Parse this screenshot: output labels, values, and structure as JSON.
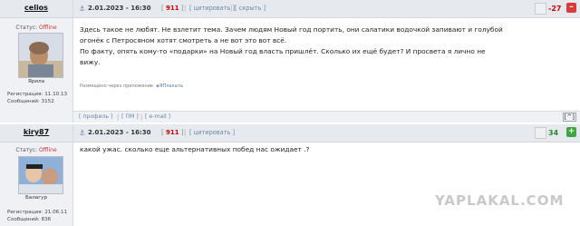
{
  "posts": [
    {
      "username": "celios",
      "status_label": "Статус:",
      "status_value": "Offline",
      "avatar_caption": "Ярила",
      "reg_label": "Регистрация:",
      "reg_date": "11.10.13",
      "msg_label": "Сообщений:",
      "msg_count": "3152",
      "date": "2.01.2023 - 16:30",
      "post_number": "911",
      "quote_label": "цитировать",
      "hide_label": "скрыть",
      "score": "-27",
      "score_color": "#cc0000",
      "body_lines": [
        "Здесь такое не любят. Не взлетит тема. Зачем людям Новый год портить, они салатики водочкой запивают и голубой",
        "огонёк с Петросяном хотят смотреть а не вот это вот всё.",
        "По факту, опять кому-то «подарки» на Новый год власть пришлёт. Сколько их ещё будет? И просвета я лично не",
        "вижу."
      ],
      "via_text": "Размещено через приложение",
      "via_app": "ЯПлакалъ",
      "footer_links": [
        "профиль",
        "ПМ",
        "e-mail"
      ]
    },
    {
      "username": "kiry87",
      "status_label": "Статус:",
      "status_value": "Offline",
      "avatar_caption": "Балагур",
      "reg_label": "Регистрация:",
      "reg_date": "21.06.11",
      "msg_label": "Сообщений:",
      "msg_count": "836",
      "date": "2.01.2023 - 16:30",
      "post_number": "911",
      "quote_label": "цитировать",
      "score": "34",
      "score_color": "#2a8a2a",
      "body_lines": [
        "какой ужас. сколько еще альтернативных побед нас ожидает .?"
      ]
    }
  ],
  "watermark": "YAPLAKAL.COM",
  "up_arrow": "[^]",
  "icons": [
    "anchor-icon",
    "plus-vote-icon",
    "minus-vote-icon",
    "up-arrow-icon"
  ]
}
